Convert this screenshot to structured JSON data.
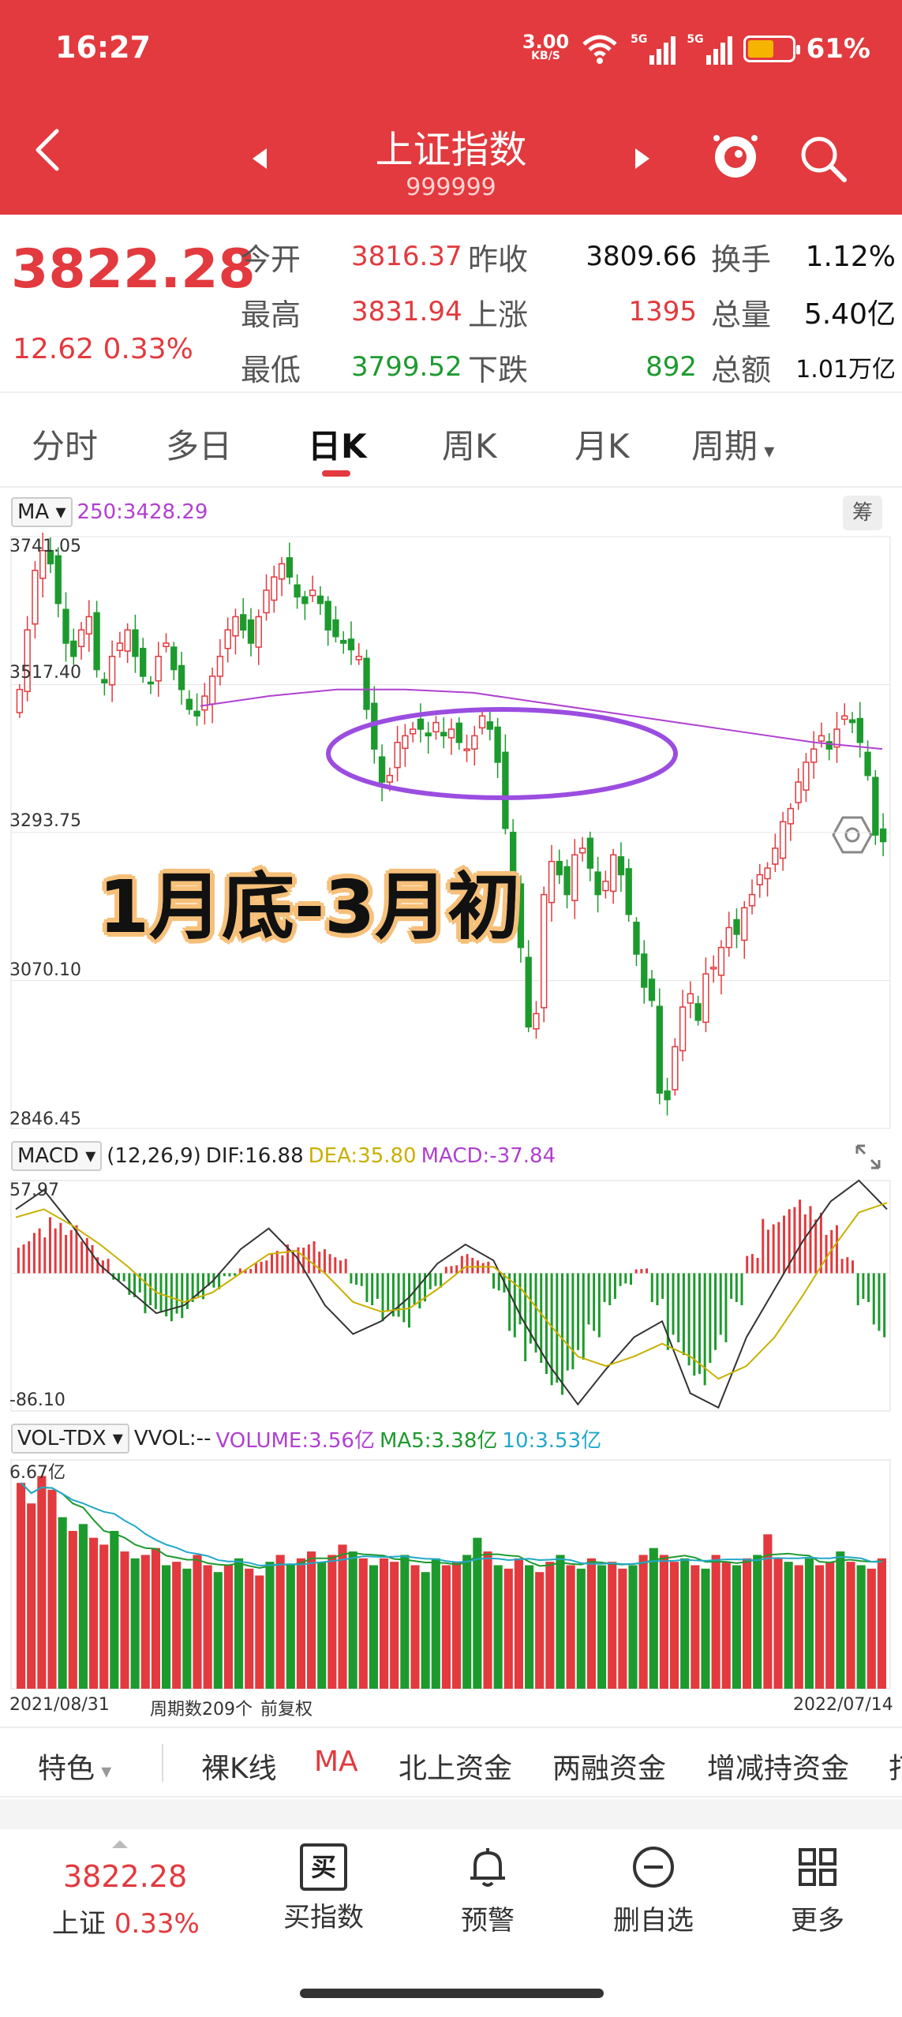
{
  "status_bar": {
    "time": "16:27",
    "net_speed_value": "3.00",
    "net_speed_unit": "KB/S",
    "battery": "61%"
  },
  "header": {
    "title": "上证指数",
    "code": "999999"
  },
  "quote": {
    "price": "3822.28",
    "change": "12.62 0.33%",
    "rows": [
      {
        "l1": "今开",
        "v1": "3816.37",
        "l2": "昨收",
        "v2": "3809.66",
        "l3": "换手",
        "v3": "1.12%"
      },
      {
        "l1": "最高",
        "v1": "3831.94",
        "l2": "上涨",
        "v2": "1395",
        "l3": "总量",
        "v3": "5.40亿"
      },
      {
        "l1": "最低",
        "v1": "3799.52",
        "l2": "下跌",
        "v2": "892",
        "l3": "总额",
        "v3": "1.01万亿"
      }
    ]
  },
  "tabs": [
    "分时",
    "多日",
    "日K",
    "周K",
    "月K",
    "周期"
  ],
  "kline": {
    "ma_label": "MA",
    "ma250": "250:3428.29",
    "chip_label": "筹",
    "y_ticks": [
      "3741.05",
      "3517.40",
      "3293.75",
      "3070.10",
      "2846.45"
    ],
    "annotation": "1月底-3月初"
  },
  "macd": {
    "label": "MACD",
    "params": "(12,26,9)",
    "dif": "DIF:16.88",
    "dea": "DEA:35.80",
    "macd": "MACD:-37.84",
    "y_top": "57.97",
    "y_bottom": "-86.10"
  },
  "vol": {
    "label": "VOL-TDX",
    "vvol": "VVOL:--",
    "volume": "VOLUME:3.56亿",
    "ma5": "MA5:3.38亿",
    "ma10": "10:3.53亿",
    "y_top": "6.67亿",
    "date_start": "2021/08/31",
    "period_count": "周期数209个",
    "adjust": "前复权",
    "date_end": "2022/07/14"
  },
  "toolbar": [
    "特色",
    "裸K线",
    "MA",
    "北上资金",
    "两融资金",
    "增减持资金",
    "打"
  ],
  "bottom_bar": {
    "price": "3822.28",
    "name": "上证",
    "pct": "0.33%",
    "items": [
      "买指数",
      "预警",
      "删自选",
      "更多"
    ],
    "buy_icon_char": "买"
  },
  "colors": {
    "up": "#e23a3e",
    "down": "#1d9a2e",
    "ma250": "#b040d0",
    "dea": "#c8b000",
    "macd_lines": "#333333",
    "ma10": "#22a8c8"
  },
  "chart_data": [
    {
      "type": "candlestick",
      "title": "上证指数 日K",
      "x_range": [
        "2021/08/31",
        "2022/07/14"
      ],
      "ylim": [
        2846.45,
        3741.05
      ],
      "y_ticks": [
        3741.05,
        3517.4,
        3293.75,
        3070.1,
        2846.45
      ],
      "trend_close": [
        3510,
        3600,
        3690,
        3720,
        3700,
        3640,
        3580,
        3560,
        3600,
        3620,
        3540,
        3520,
        3560,
        3580,
        3600,
        3560,
        3530,
        3520,
        3560,
        3580,
        3540,
        3510,
        3480,
        3470,
        3500,
        3530,
        3560,
        3600,
        3620,
        3600,
        3580,
        3620,
        3660,
        3680,
        3700,
        3680,
        3650,
        3640,
        3660,
        3640,
        3600,
        3590,
        3580,
        3570,
        3560,
        3480,
        3420,
        3370,
        3380,
        3430,
        3440,
        3450,
        3450,
        3440,
        3460,
        3440,
        3450,
        3430,
        3420,
        3440,
        3470,
        3450,
        3400,
        3300,
        3210,
        3120,
        3000,
        3020,
        3200,
        3250,
        3230,
        3200,
        3260,
        3270,
        3240,
        3200,
        3220,
        3260,
        3230,
        3170,
        3110,
        3060,
        3040,
        2900,
        2890,
        2970,
        3030,
        3050,
        3010,
        3080,
        3090,
        3120,
        3150,
        3140,
        3180,
        3200,
        3230,
        3240,
        3270,
        3310,
        3330,
        3370,
        3400,
        3420,
        3440,
        3420,
        3450,
        3470,
        3460,
        3430,
        3380,
        3290,
        3280
      ],
      "ma250_y": [
        3485,
        3500,
        3510,
        3510,
        3505,
        3490,
        3475,
        3460,
        3445,
        3430,
        3420
      ],
      "annotation": "1月底-3月初"
    },
    {
      "type": "macd",
      "params": [
        12,
        26,
        9
      ],
      "dif": 16.88,
      "dea": 35.8,
      "macd": -37.84,
      "ylim": [
        -86.1,
        57.97
      ],
      "hist": [
        20,
        28,
        35,
        30,
        22,
        10,
        -5,
        -15,
        -25,
        -30,
        -28,
        -18,
        -10,
        -2,
        3,
        8,
        14,
        18,
        20,
        15,
        10,
        -8,
        -20,
        -30,
        -34,
        -22,
        -10,
        5,
        12,
        8,
        -12,
        -40,
        -55,
        -70,
        -76,
        -60,
        -40,
        -20,
        -8,
        3,
        -20,
        -48,
        -64,
        -70,
        -48,
        -20,
        12,
        34,
        40,
        46,
        42,
        30,
        10,
        -20,
        -40
      ],
      "dif_line": [
        40,
        52,
        30,
        5,
        -10,
        -25,
        -20,
        -5,
        15,
        28,
        10,
        -20,
        -38,
        -30,
        -15,
        6,
        18,
        8,
        -28,
        -58,
        -82,
        -60,
        -40,
        -30,
        -75,
        -84,
        -40,
        -10,
        20,
        45,
        58,
        40
      ],
      "dea_line": [
        35,
        40,
        30,
        18,
        4,
        -12,
        -18,
        -12,
        0,
        12,
        14,
        0,
        -18,
        -24,
        -22,
        -10,
        4,
        4,
        -10,
        -32,
        -52,
        -58,
        -52,
        -44,
        -52,
        -66,
        -58,
        -40,
        -14,
        14,
        38,
        44
      ]
    },
    {
      "type": "bar",
      "title": "VOL-TDX",
      "ylim": [
        0,
        6.67
      ],
      "unit": "亿",
      "volume": 3.56,
      "ma5": 3.38,
      "ma10": 3.53,
      "values": [
        6.0,
        5.4,
        6.2,
        5.8,
        5.0,
        4.6,
        4.8,
        4.4,
        4.2,
        4.6,
        4.0,
        3.8,
        3.9,
        4.1,
        3.6,
        3.7,
        3.5,
        3.9,
        3.6,
        3.4,
        3.6,
        3.8,
        3.5,
        3.3,
        3.7,
        3.9,
        3.6,
        3.8,
        4.0,
        3.7,
        3.9,
        4.2,
        4.0,
        3.8,
        3.6,
        3.8,
        3.7,
        3.9,
        3.6,
        3.4,
        3.8,
        3.6,
        3.7,
        3.9,
        4.4,
        4.0,
        3.6,
        3.5,
        3.8,
        3.6,
        3.4,
        3.7,
        3.9,
        3.6,
        3.5,
        3.8,
        3.6,
        3.7,
        3.5,
        3.6,
        3.9,
        4.1,
        3.9,
        3.7,
        3.8,
        3.6,
        3.5,
        3.9,
        3.7,
        3.6,
        3.8,
        3.9,
        4.5,
        3.8,
        3.7,
        3.6,
        3.8,
        3.6,
        3.7,
        4.0,
        3.7,
        3.6,
        3.5,
        3.8
      ],
      "up_flags": [
        1,
        1,
        1,
        1,
        0,
        1,
        0,
        1,
        1,
        0,
        1,
        0,
        1,
        1,
        0,
        1,
        0,
        1,
        1,
        0,
        1,
        0,
        1,
        1,
        0,
        1,
        0,
        1,
        1,
        0,
        1,
        1,
        0,
        1,
        0,
        1,
        1,
        0,
        1,
        0,
        0,
        1,
        1,
        0,
        0,
        1,
        0,
        1,
        1,
        0,
        1,
        1,
        0,
        1,
        0,
        1,
        0,
        1,
        1,
        0,
        1,
        0,
        1,
        1,
        0,
        1,
        0,
        1,
        1,
        0,
        1,
        0,
        1,
        1,
        0,
        1,
        0,
        1,
        1,
        0,
        1,
        0,
        1,
        1
      ]
    }
  ]
}
